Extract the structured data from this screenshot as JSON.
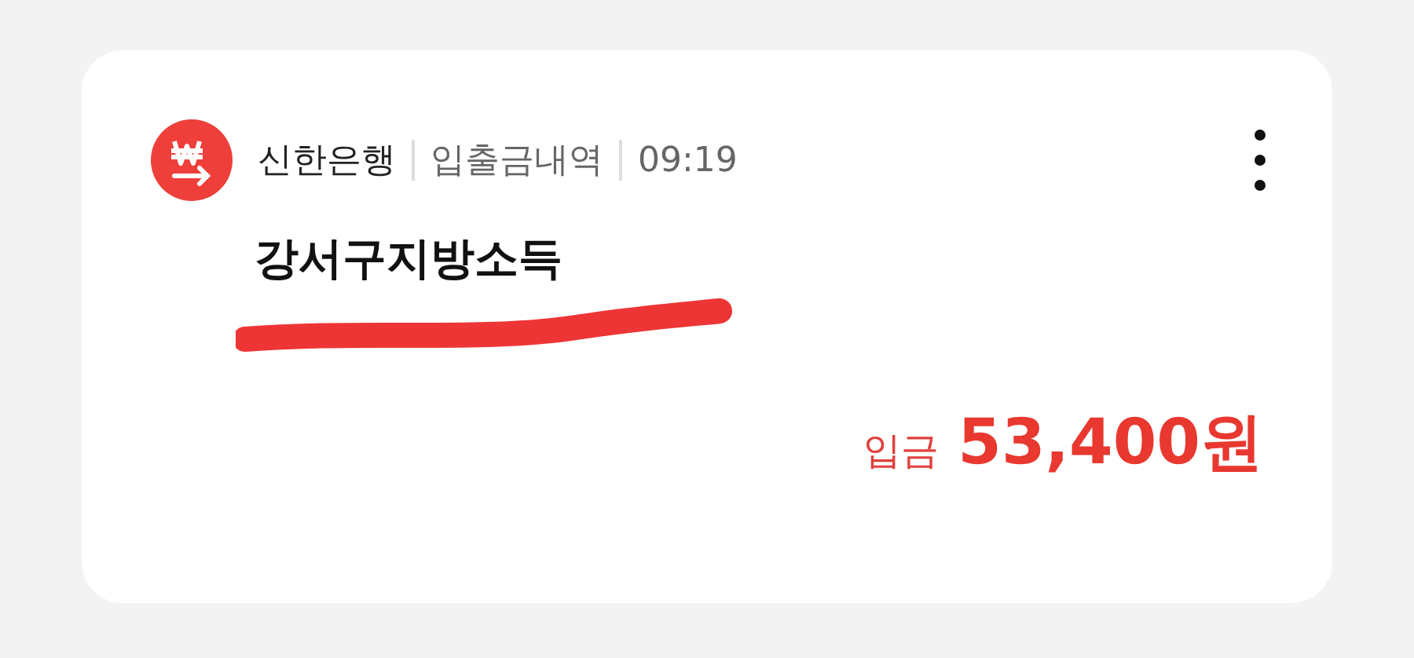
{
  "notification": {
    "app_name": "신한은행",
    "category": "입출금내역",
    "time": "09:19",
    "title": "강서구지방소득",
    "transaction": {
      "type_label": "입금",
      "amount": "53,400원"
    }
  }
}
